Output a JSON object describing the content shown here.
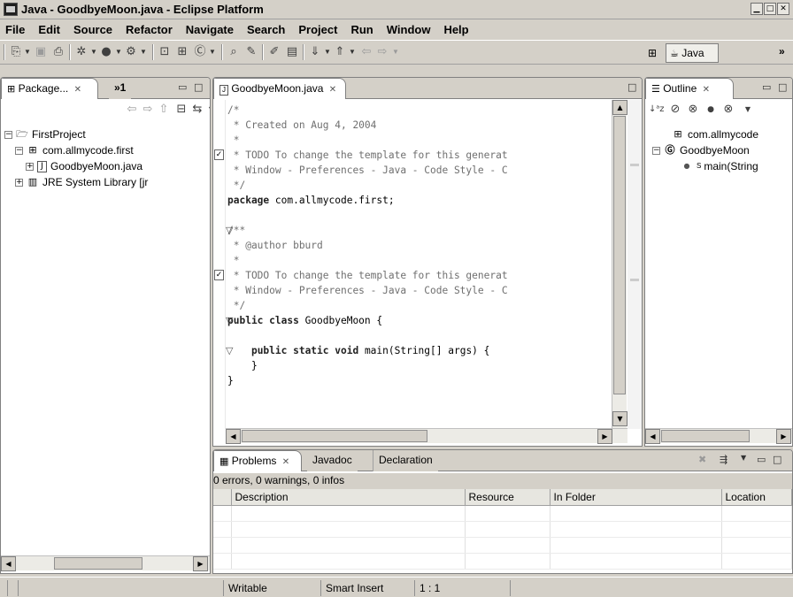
{
  "window": {
    "title": "Java - GoodbyeMoon.java - Eclipse Platform"
  },
  "menu": [
    "File",
    "Edit",
    "Source",
    "Refactor",
    "Navigate",
    "Search",
    "Project",
    "Run",
    "Window",
    "Help"
  ],
  "perspective": {
    "label": "Java",
    "more": "»"
  },
  "package_explorer": {
    "tab": "Package...",
    "more_tabs": "»1",
    "tree": [
      {
        "label": "FirstProject",
        "icon": "project-folder-icon",
        "expander": "−",
        "level": 0
      },
      {
        "label": "com.allmycode.first",
        "icon": "package-icon",
        "expander": "−",
        "level": 1
      },
      {
        "label": "GoodbyeMoon.java",
        "icon": "java-file-icon",
        "expander": "+",
        "level": 2
      },
      {
        "label": "JRE System Library [jr",
        "icon": "library-icon",
        "expander": "+",
        "level": 1
      }
    ]
  },
  "editor": {
    "tab": "GoodbyeMoon.java",
    "lines": [
      {
        "fold": "",
        "marker": "",
        "segs": [
          [
            "c",
            "/*"
          ]
        ]
      },
      {
        "fold": "",
        "marker": "",
        "segs": [
          [
            "c",
            " * Created on Aug 4, 2004"
          ]
        ]
      },
      {
        "fold": "",
        "marker": "",
        "segs": [
          [
            "c",
            " *"
          ]
        ]
      },
      {
        "fold": "",
        "marker": "task",
        "segs": [
          [
            "c",
            " * TODO To change the template for this generat"
          ]
        ]
      },
      {
        "fold": "",
        "marker": "",
        "segs": [
          [
            "c",
            " * Window - Preferences - Java - Code Style - C"
          ]
        ]
      },
      {
        "fold": "",
        "marker": "",
        "segs": [
          [
            "c",
            " */"
          ]
        ]
      },
      {
        "fold": "",
        "marker": "",
        "segs": [
          [
            "k",
            "package"
          ],
          [
            "n",
            " com.allmycode.first;"
          ]
        ]
      },
      {
        "fold": "",
        "marker": "",
        "segs": [
          [
            "n",
            ""
          ]
        ]
      },
      {
        "fold": "▽",
        "marker": "",
        "segs": [
          [
            "c",
            "/**"
          ]
        ]
      },
      {
        "fold": "",
        "marker": "",
        "segs": [
          [
            "c",
            " * @author bburd"
          ]
        ]
      },
      {
        "fold": "",
        "marker": "",
        "segs": [
          [
            "c",
            " *"
          ]
        ]
      },
      {
        "fold": "",
        "marker": "task",
        "segs": [
          [
            "c",
            " * TODO To change the template for this generat"
          ]
        ]
      },
      {
        "fold": "",
        "marker": "",
        "segs": [
          [
            "c",
            " * Window - Preferences - Java - Code Style - C"
          ]
        ]
      },
      {
        "fold": "",
        "marker": "",
        "segs": [
          [
            "c",
            " */"
          ]
        ]
      },
      {
        "fold": "▽",
        "marker": "",
        "segs": [
          [
            "k",
            "public class"
          ],
          [
            "n",
            " GoodbyeMoon {"
          ]
        ]
      },
      {
        "fold": "",
        "marker": "",
        "segs": [
          [
            "n",
            ""
          ]
        ]
      },
      {
        "fold": "▽",
        "marker": "",
        "segs": [
          [
            "n",
            "    "
          ],
          [
            "k",
            "public static void"
          ],
          [
            "n",
            " main(String[] args) {"
          ]
        ]
      },
      {
        "fold": "",
        "marker": "",
        "segs": [
          [
            "n",
            "    }"
          ]
        ]
      },
      {
        "fold": "",
        "marker": "",
        "segs": [
          [
            "n",
            "}"
          ]
        ]
      }
    ]
  },
  "outline": {
    "tab": "Outline",
    "tree": [
      {
        "label": "com.allmycode",
        "icon": "package-icon",
        "level": 0
      },
      {
        "label": "GoodbyeMoon",
        "icon": "class-icon",
        "expander": "−",
        "level": 0
      },
      {
        "label": "main(String",
        "icon": "method-icon",
        "sup": "S",
        "level": 1
      }
    ]
  },
  "problems": {
    "tabs": [
      "Problems",
      "Javadoc",
      "Declaration"
    ],
    "summary": "0 errors, 0 warnings, 0 infos",
    "columns": [
      "Description",
      "Resource",
      "In Folder",
      "Location"
    ]
  },
  "status": {
    "writable": "Writable",
    "insert_mode": "Smart Insert",
    "position": "1 : 1"
  }
}
